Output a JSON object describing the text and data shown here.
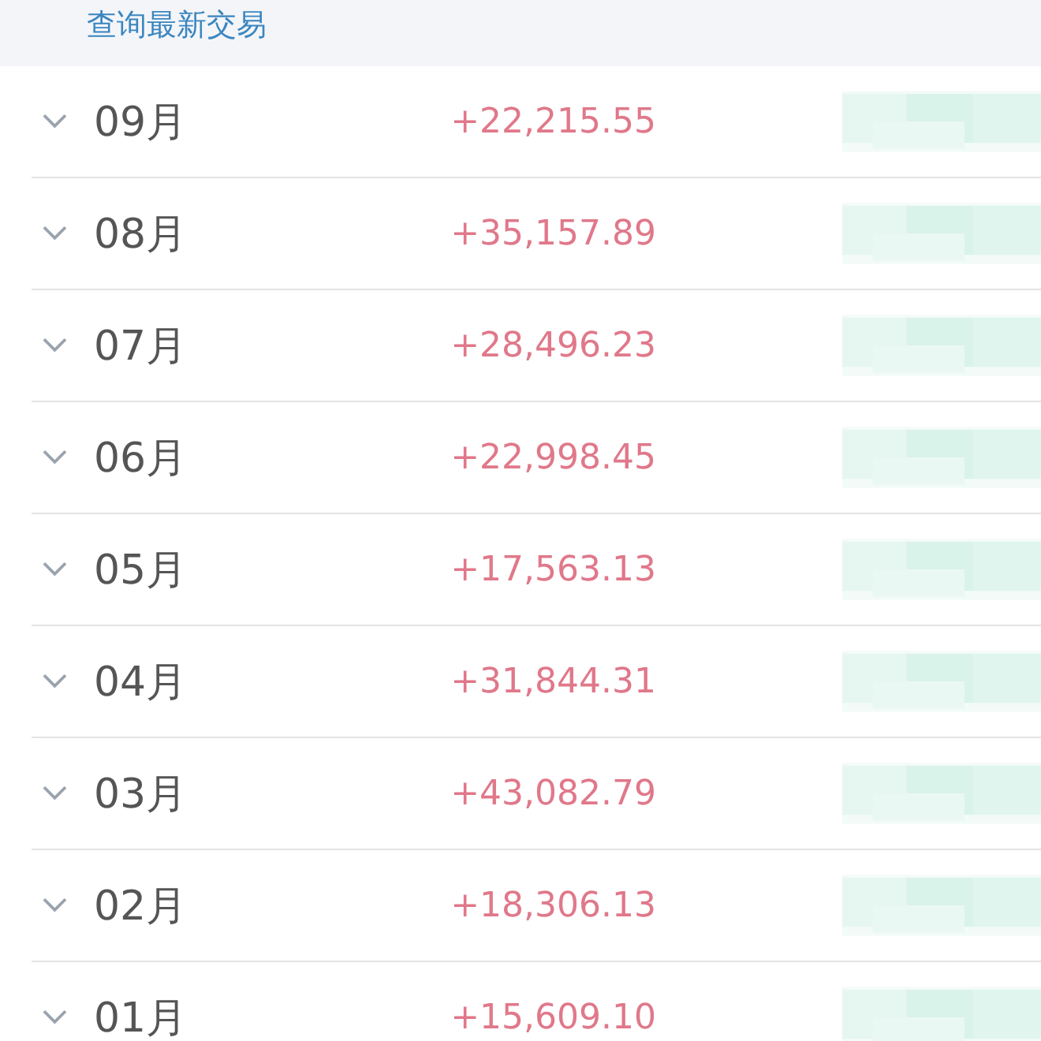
{
  "header": {
    "link": "查询最新交易"
  },
  "months": [
    {
      "month": "09月",
      "income": "+22,215.55"
    },
    {
      "month": "08月",
      "income": "+35,157.89"
    },
    {
      "month": "07月",
      "income": "+28,496.23"
    },
    {
      "month": "06月",
      "income": "+22,998.45"
    },
    {
      "month": "05月",
      "income": "+17,563.13"
    },
    {
      "month": "04月",
      "income": "+31,844.31"
    },
    {
      "month": "03月",
      "income": "+43,082.79"
    },
    {
      "month": "02月",
      "income": "+18,306.13"
    },
    {
      "month": "01月",
      "income": "+15,609.10"
    }
  ]
}
